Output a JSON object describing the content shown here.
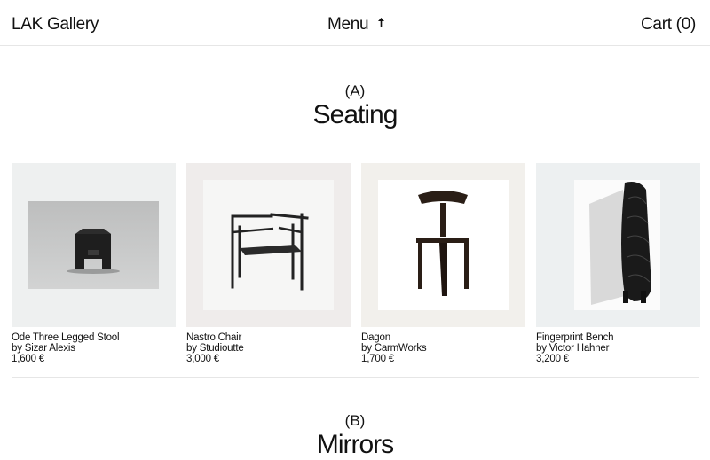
{
  "header": {
    "brand": "LAK Gallery",
    "menu_label": "Menu",
    "menu_icon": "arrow-up-icon",
    "cart_label": "Cart (0)"
  },
  "sections": [
    {
      "letter": "(A)",
      "title": "Seating"
    },
    {
      "letter": "(B)",
      "title": "Mirrors"
    }
  ],
  "products": [
    {
      "name": "Ode Three Legged Stool",
      "maker": "by Sizar Alexis",
      "price": "1,600 €"
    },
    {
      "name": "Nastro Chair",
      "maker": "by Studioutte",
      "price": "3,000 €"
    },
    {
      "name": "Dagon",
      "maker": "by CarmWorks",
      "price": "1,700 €"
    },
    {
      "name": "Fingerprint Bench",
      "maker": "by Victor Hahner",
      "price": "3,200 €"
    }
  ],
  "colors": {
    "thumb_bg_1": "#eef0f0",
    "thumb_bg_2": "#efeceb",
    "thumb_bg_3": "#f2f0ec",
    "thumb_bg_4": "#edf0f1",
    "divider": "#e6e6e6"
  }
}
